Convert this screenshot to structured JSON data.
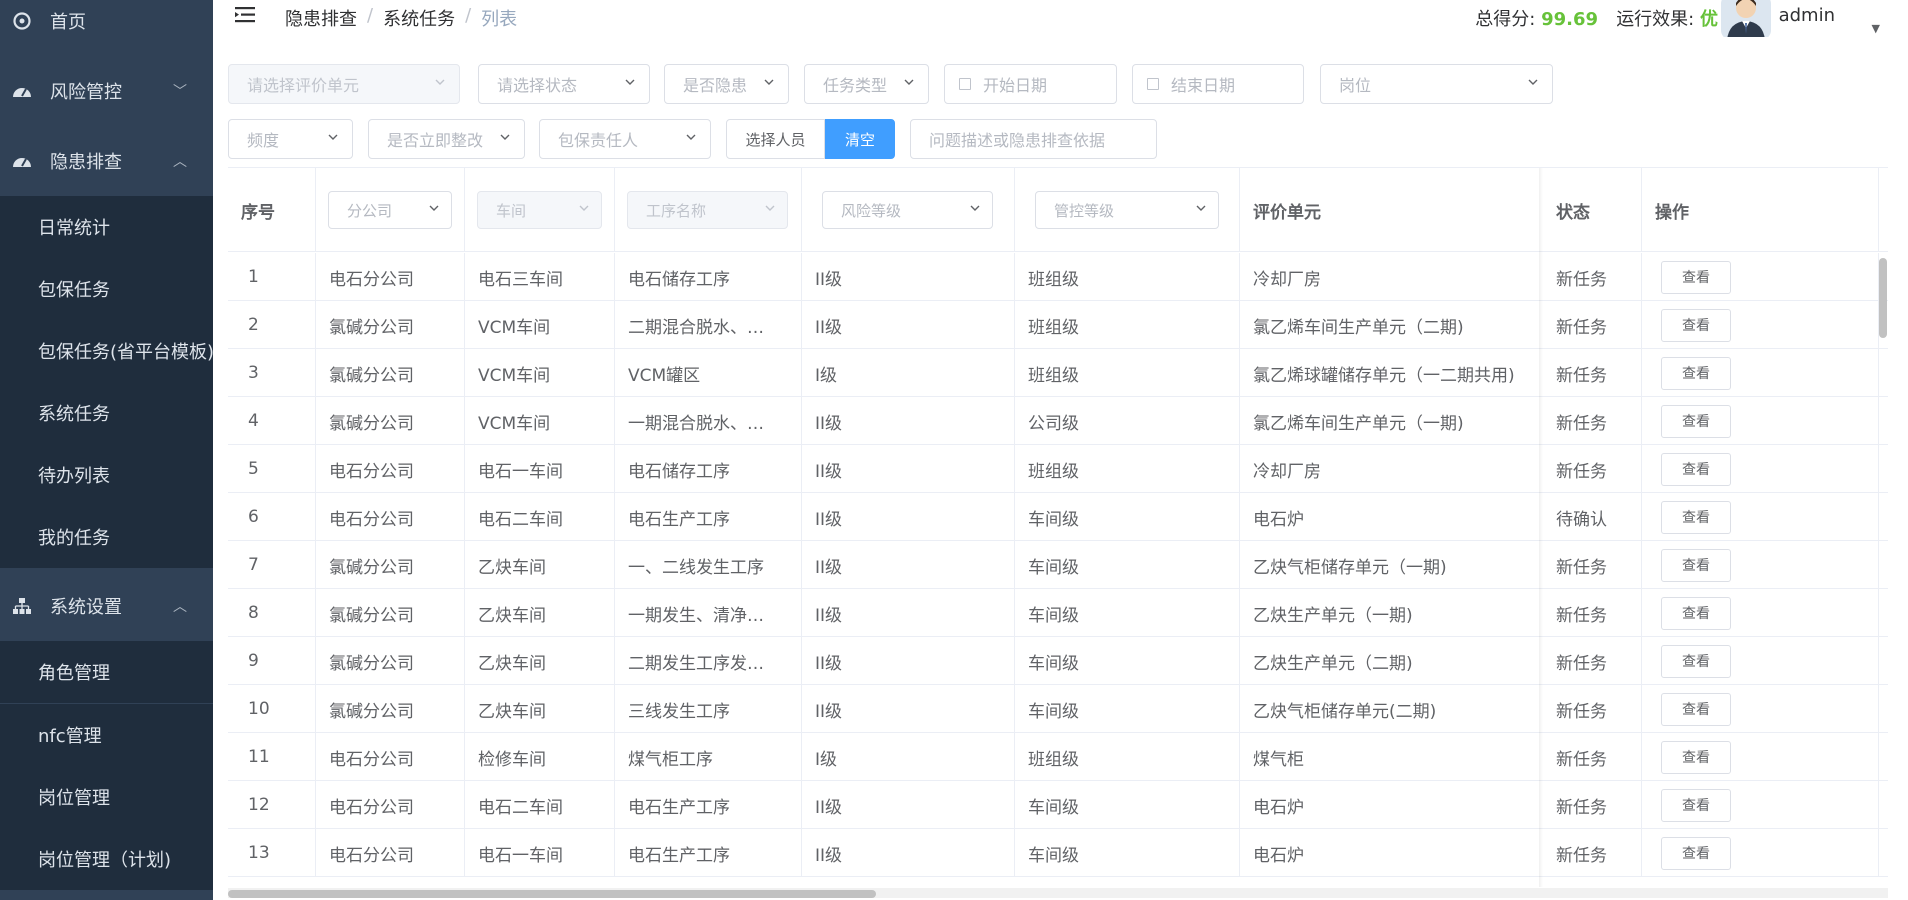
{
  "sidebar": {
    "items": [
      {
        "label": "首页",
        "icon": "dashboard-icon"
      },
      {
        "label": "风险管控",
        "icon": "dashboard-icon",
        "arrow": "﹀"
      },
      {
        "label": "隐患排查",
        "icon": "dashboard-icon",
        "arrow": "︿"
      },
      {
        "label": "系统设置",
        "icon": "sitemap-icon",
        "arrow": "︿"
      }
    ],
    "sub_hazard": [
      "日常统计",
      "包保任务",
      "包保任务(省平台模板)",
      "系统任务",
      "待办列表",
      "我的任务"
    ],
    "sub_settings": [
      "角色管理",
      "nfc管理",
      "岗位管理",
      "岗位管理（计划)"
    ]
  },
  "header": {
    "breadcrumb": [
      "隐患排查",
      "系统任务",
      "列表"
    ],
    "score_label": "总得分:",
    "score_value": "99.69",
    "effect_label": "运行效果:",
    "effect_value": "优",
    "username": "admin"
  },
  "filters": {
    "eval_unit": "请选择评价单元",
    "status": "请选择状态",
    "is_hazard": "是否隐患",
    "task_type": "任务类型",
    "start_date": "开始日期",
    "end_date": "结束日期",
    "post": "岗位",
    "frequency": "频度",
    "immediate": "是否立即整改",
    "responsible": "包保责任人",
    "select_person": "选择人员",
    "clear": "清空",
    "search_placeholder": "问题描述或隐患排查依据"
  },
  "table": {
    "headers": {
      "index": "序号",
      "branch": "分公司",
      "workshop": "车间",
      "process": "工序名称",
      "risk": "风险等级",
      "control": "管控等级",
      "unit": "评价单元",
      "status": "状态",
      "action": "操作"
    },
    "view_label": "查看",
    "rows": [
      {
        "no": "1",
        "branch": "电石分公司",
        "workshop": "电石三车间",
        "process": "电石储存工序",
        "risk": "II级",
        "control": "班组级",
        "unit": "冷却厂房",
        "status": "新任务"
      },
      {
        "no": "2",
        "branch": "氯碱分公司",
        "workshop": "VCM车间",
        "process": "二期混合脱水、…",
        "risk": "II级",
        "control": "班组级",
        "unit": "氯乙烯车间生产单元（二期)",
        "status": "新任务"
      },
      {
        "no": "3",
        "branch": "氯碱分公司",
        "workshop": "VCM车间",
        "process": "VCM罐区",
        "risk": "I级",
        "control": "班组级",
        "unit": "氯乙烯球罐储存单元（一二期共用)",
        "status": "新任务"
      },
      {
        "no": "4",
        "branch": "氯碱分公司",
        "workshop": "VCM车间",
        "process": "一期混合脱水、…",
        "risk": "II级",
        "control": "公司级",
        "unit": "氯乙烯车间生产单元（一期)",
        "status": "新任务"
      },
      {
        "no": "5",
        "branch": "电石分公司",
        "workshop": "电石一车间",
        "process": "电石储存工序",
        "risk": "II级",
        "control": "班组级",
        "unit": "冷却厂房",
        "status": "新任务"
      },
      {
        "no": "6",
        "branch": "电石分公司",
        "workshop": "电石二车间",
        "process": "电石生产工序",
        "risk": "II级",
        "control": "车间级",
        "unit": "电石炉",
        "status": "待确认"
      },
      {
        "no": "7",
        "branch": "氯碱分公司",
        "workshop": "乙炔车间",
        "process": "一、二线发生工序",
        "risk": "II级",
        "control": "车间级",
        "unit": "乙炔气柜储存单元（一期)",
        "status": "新任务"
      },
      {
        "no": "8",
        "branch": "氯碱分公司",
        "workshop": "乙炔车间",
        "process": "一期发生、清净…",
        "risk": "II级",
        "control": "车间级",
        "unit": "乙炔生产单元（一期)",
        "status": "新任务"
      },
      {
        "no": "9",
        "branch": "氯碱分公司",
        "workshop": "乙炔车间",
        "process": "二期发生工序发…",
        "risk": "II级",
        "control": "车间级",
        "unit": "乙炔生产单元（二期)",
        "status": "新任务"
      },
      {
        "no": "10",
        "branch": "氯碱分公司",
        "workshop": "乙炔车间",
        "process": "三线发生工序",
        "risk": "II级",
        "control": "车间级",
        "unit": "乙炔气柜储存单元(二期)",
        "status": "新任务"
      },
      {
        "no": "11",
        "branch": "电石分公司",
        "workshop": "检修车间",
        "process": "煤气柜工序",
        "risk": "I级",
        "control": "班组级",
        "unit": "煤气柜",
        "status": "新任务"
      },
      {
        "no": "12",
        "branch": "电石分公司",
        "workshop": "电石二车间",
        "process": "电石生产工序",
        "risk": "II级",
        "control": "车间级",
        "unit": "电石炉",
        "status": "新任务"
      },
      {
        "no": "13",
        "branch": "电石分公司",
        "workshop": "电石一车间",
        "process": "电石生产工序",
        "risk": "II级",
        "control": "车间级",
        "unit": "电石炉",
        "status": "新任务"
      }
    ]
  }
}
